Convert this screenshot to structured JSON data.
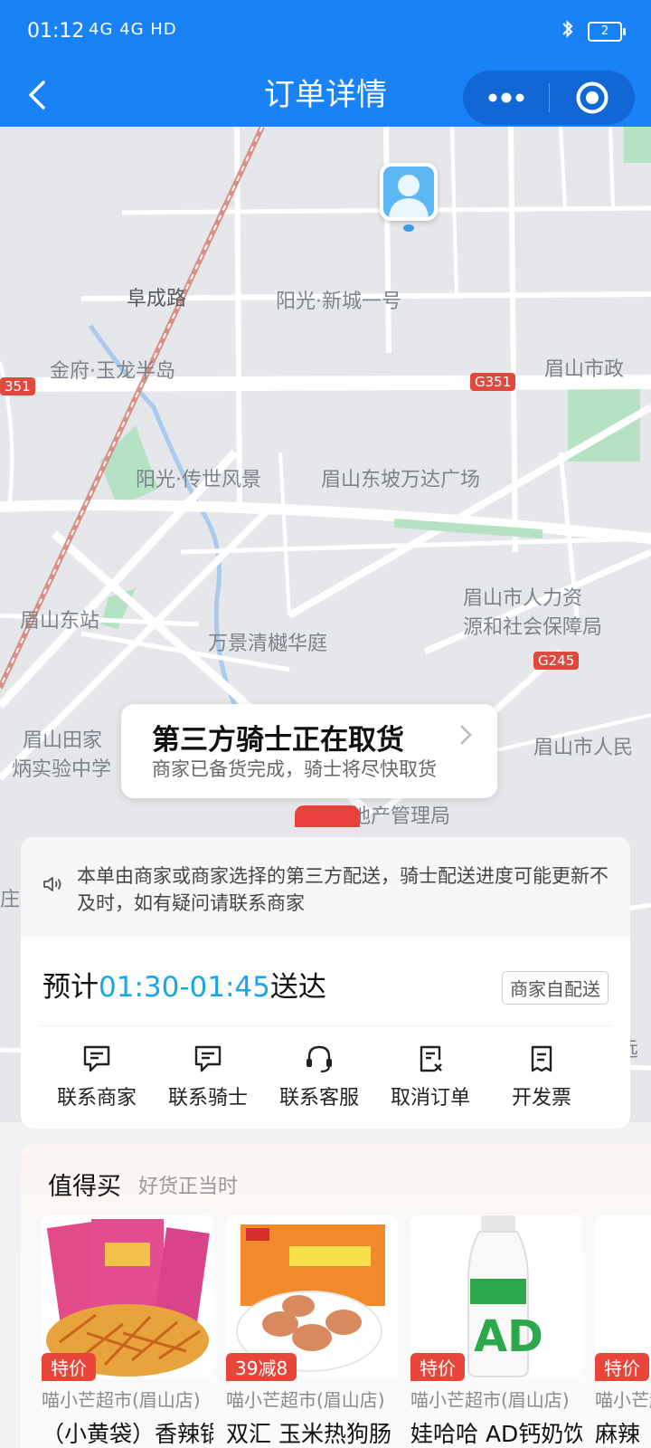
{
  "status": {
    "time": "01:12",
    "signal": "4G 4G HD",
    "battery": "2"
  },
  "nav": {
    "title": "订单详情"
  },
  "map": {
    "labels": [
      "阜成路",
      "阳光·新城一号",
      "金府·玉龙半岛",
      "眉山市政",
      "阳光·传世风景",
      "眉山东坡万达广场",
      "眉山市人力资",
      "源和社会保障局",
      "眉山东站",
      "万景清樾华庭",
      "眉山田家",
      "炳实验中学",
      "眉山市人民",
      "地产管理局",
      "庄",
      "远"
    ],
    "road_badges": [
      "351",
      "G351",
      "G245"
    ]
  },
  "callout": {
    "title": "第三方骑士正在取货",
    "subtitle": "商家已备货完成，骑士将尽快取货"
  },
  "notice": {
    "text": "本单由商家或商家选择的第三方配送，骑士配送进度可能更新不及时，如有疑问请联系商家"
  },
  "eta": {
    "prefix": "预计",
    "time": "01:30-01:45",
    "suffix": "送达",
    "tag": "商家自配送"
  },
  "actions": [
    {
      "label": "联系商家",
      "icon": "chat-icon"
    },
    {
      "label": "联系骑士",
      "icon": "chat-icon"
    },
    {
      "label": "联系客服",
      "icon": "headset-icon"
    },
    {
      "label": "取消订单",
      "icon": "cancel-order-icon"
    },
    {
      "label": "开发票",
      "icon": "invoice-icon"
    }
  ],
  "recommend": {
    "title": "值得买",
    "subtitle": "好货正当时",
    "products": [
      {
        "tag": "特价",
        "shop": "喵小芒超市(眉山店)",
        "name": "（小黄袋）香辣锅"
      },
      {
        "tag": "39减8",
        "shop": "喵小芒超市(眉山店)",
        "name": "双汇 玉米热狗肠"
      },
      {
        "tag": "特价",
        "shop": "喵小芒超市(眉山店)",
        "name": "娃哈哈 AD钙奶饮"
      },
      {
        "tag": "特价",
        "shop": "喵小芒超市(眉山店)",
        "name": "麻辣"
      }
    ]
  }
}
